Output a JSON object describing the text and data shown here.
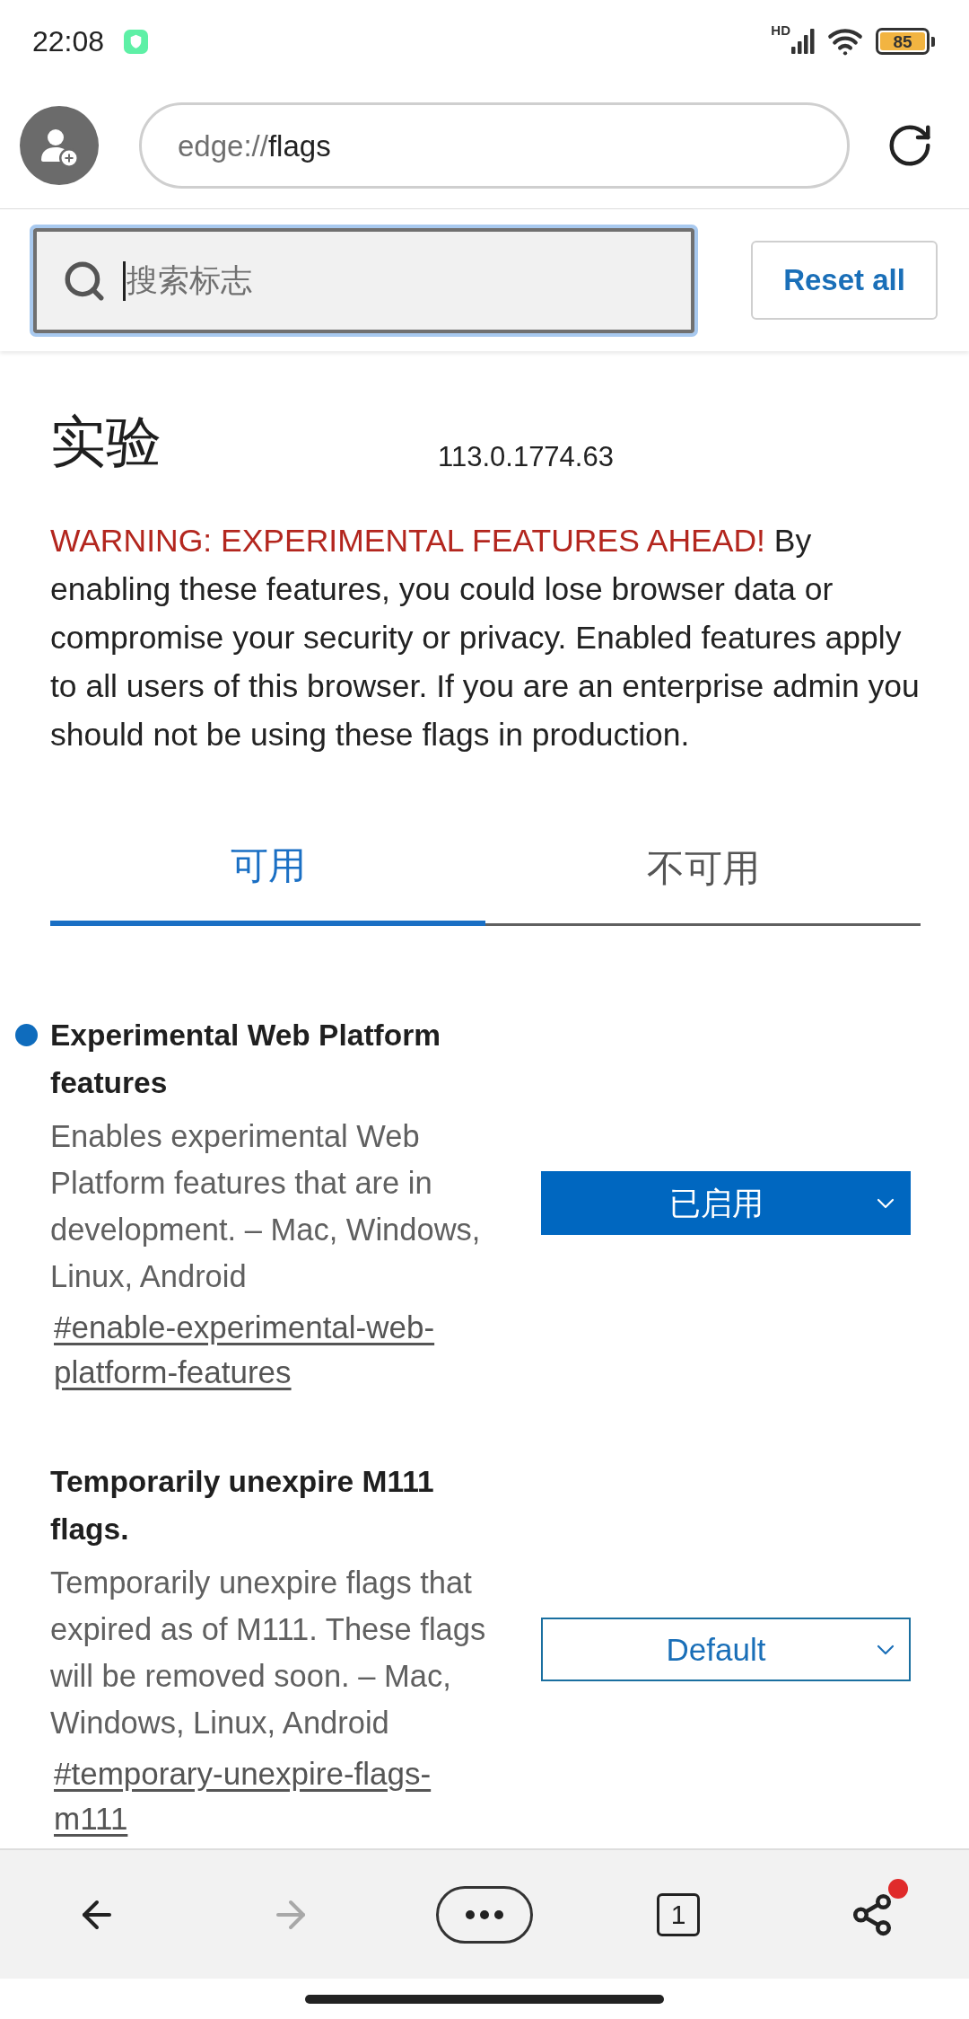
{
  "status_bar": {
    "time": "22:08",
    "network": "HD",
    "battery": "85"
  },
  "address_bar": {
    "scheme": "edge://",
    "host": "flags"
  },
  "search": {
    "placeholder": "搜索标志",
    "focused": true
  },
  "reset_button": "Reset all",
  "header": {
    "title": "实验",
    "version": "113.0.1774.63"
  },
  "warning": {
    "heading": "WARNING: EXPERIMENTAL FEATURES AHEAD!",
    "text": "By enabling these features, you could lose browser data or compromise your security or privacy. Enabled features apply to all users of this browser. If you are an enterprise admin you should not be using these flags in production."
  },
  "tabs": [
    {
      "label": "可用",
      "selected": true
    },
    {
      "label": "不可用",
      "selected": false
    }
  ],
  "flags": [
    {
      "title": "Experimental Web Platform features",
      "modified": true,
      "description": "Enables experimental Web Platform features that are in development. – Mac, Windows, Linux, Android",
      "link": "#enable-experimental-web-platform-features",
      "value": "已启用"
    },
    {
      "title": "Temporarily unexpire M111 flags.",
      "modified": false,
      "description": "Temporarily unexpire flags that expired as of M111. These flags will be removed soon. – Mac, Windows, Linux, Android",
      "link": "#temporary-unexpire-flags-m111",
      "value": "Default"
    }
  ],
  "bottom_bar": {
    "forward_enabled": false,
    "tab_count": "1",
    "share_notification": true
  }
}
